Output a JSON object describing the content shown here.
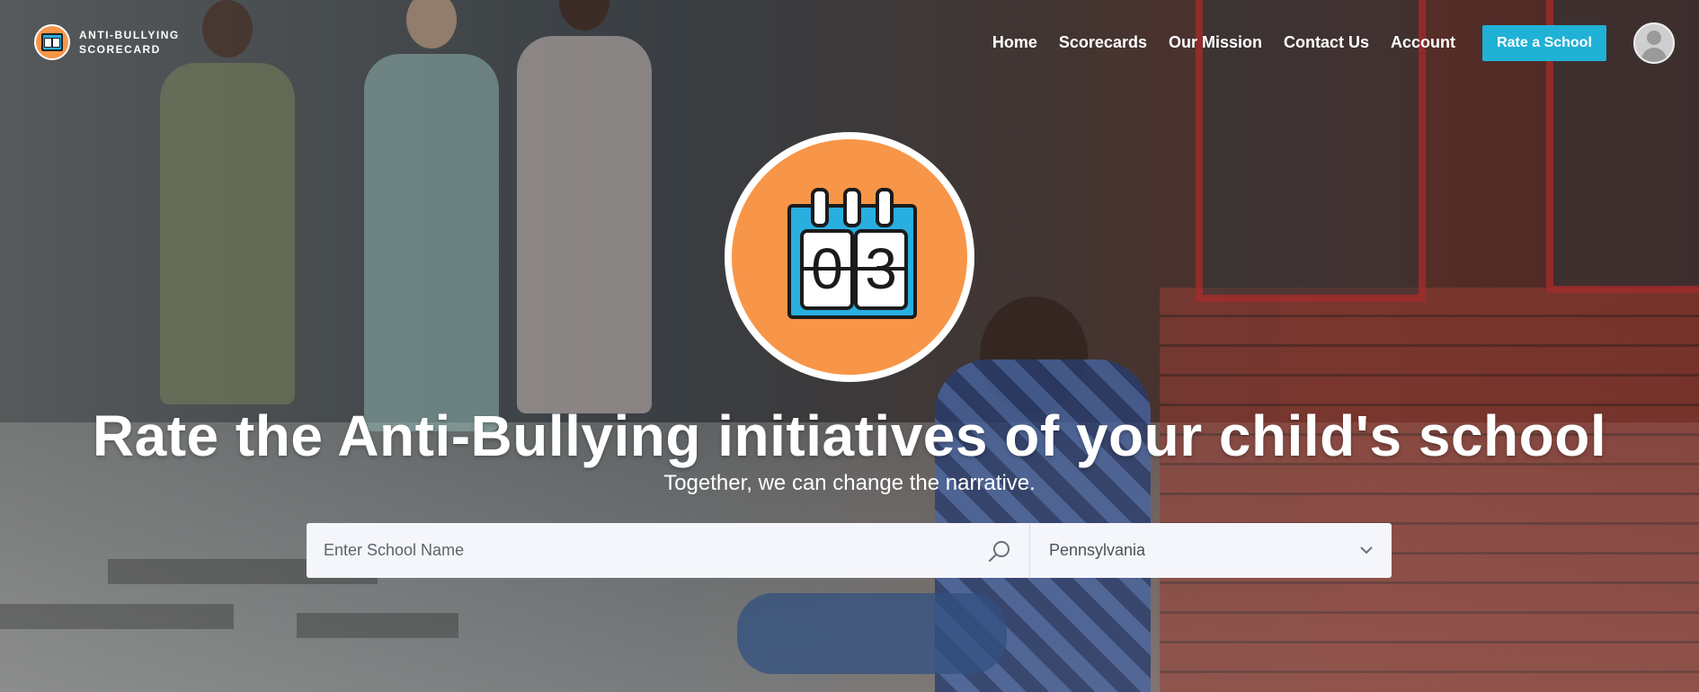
{
  "brand": {
    "line1": "ANTI-BULLYING",
    "line2": "SCORECARD",
    "logo_icon": "calendar-logo-icon"
  },
  "nav": {
    "items": [
      {
        "label": "Home"
      },
      {
        "label": "Scorecards"
      },
      {
        "label": "Our Mission"
      },
      {
        "label": "Contact Us"
      },
      {
        "label": "Account"
      }
    ],
    "cta_label": "Rate a School",
    "avatar_icon": "user-avatar-icon"
  },
  "hero": {
    "badge_digits": [
      "0",
      "3"
    ],
    "headline": "Rate the Anti-Bullying initiatives of your child's school",
    "subheadline": "Together, we can change the narrative."
  },
  "search": {
    "placeholder": "Enter School Name",
    "value": "",
    "state_selected": "Pennsylvania",
    "search_icon": "search-icon",
    "dropdown_icon": "chevron-down-icon"
  },
  "colors": {
    "accent": "#20b1d6",
    "badge_orange": "#f79548",
    "calendar_blue": "#29aee0"
  }
}
